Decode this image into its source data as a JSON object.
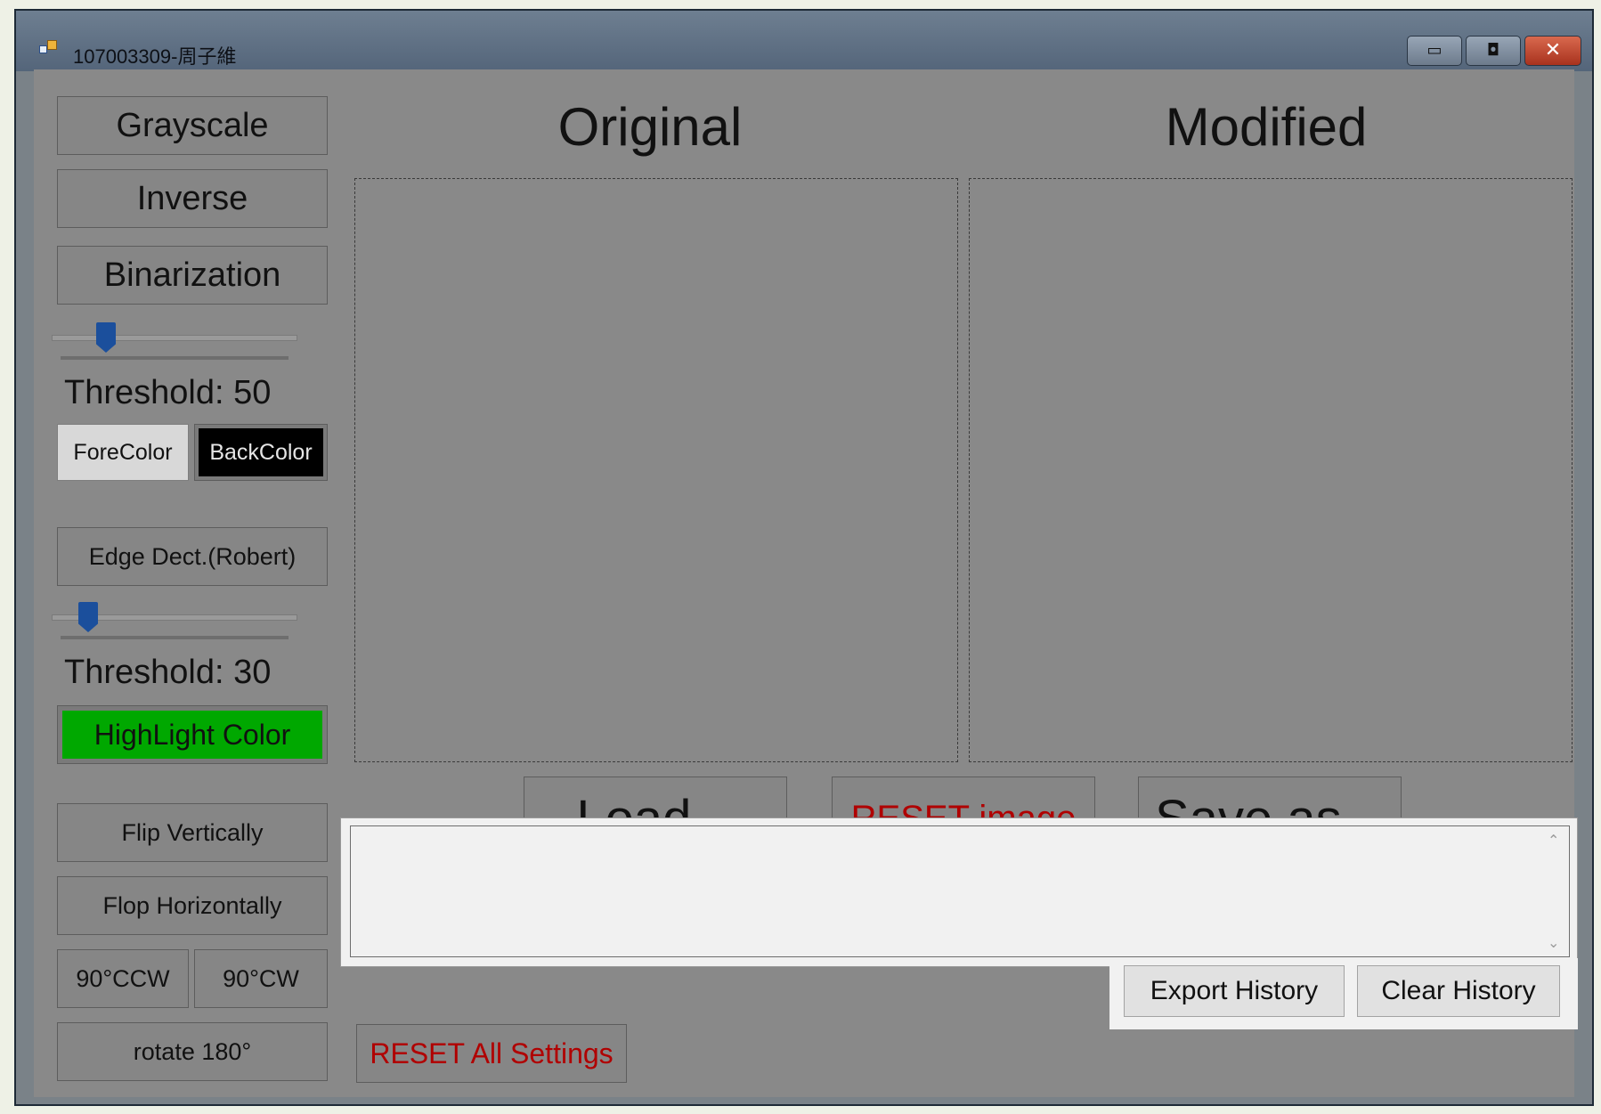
{
  "window": {
    "title": "107003309-周子維",
    "controls": {
      "minimize": "▭",
      "maximize": "◘",
      "close": "✕"
    }
  },
  "sidebar": {
    "grayscale": "Grayscale",
    "inverse": "Inverse",
    "binarization": "Binarization",
    "bin_threshold_label": "Threshold: 50",
    "bin_threshold_value": 50,
    "forecolor": "ForeColor",
    "backcolor": "BackColor",
    "edge_detect": "Edge Dect.(Robert)",
    "edge_threshold_label": "Threshold: 30",
    "edge_threshold_value": 30,
    "highlight_color": "HighLight Color",
    "flip_vertically": "Flip Vertically",
    "flop_horizontally": "Flop Horizontally",
    "rotate_ccw": "90°CCW",
    "rotate_cw": "90°CW",
    "rotate_180": "rotate 180°"
  },
  "main": {
    "original_heading": "Original",
    "modified_heading": "Modified",
    "load": "Load...",
    "reset_image": "RESET image",
    "save_as": "Save as...",
    "history_log": "",
    "reset_all": "RESET All Settings",
    "export_history": "Export History",
    "clear_history": "Clear History"
  },
  "colors": {
    "backcolor_fill": "#000000",
    "highlight_fill": "#00a800",
    "reset_text": "#b00000"
  }
}
